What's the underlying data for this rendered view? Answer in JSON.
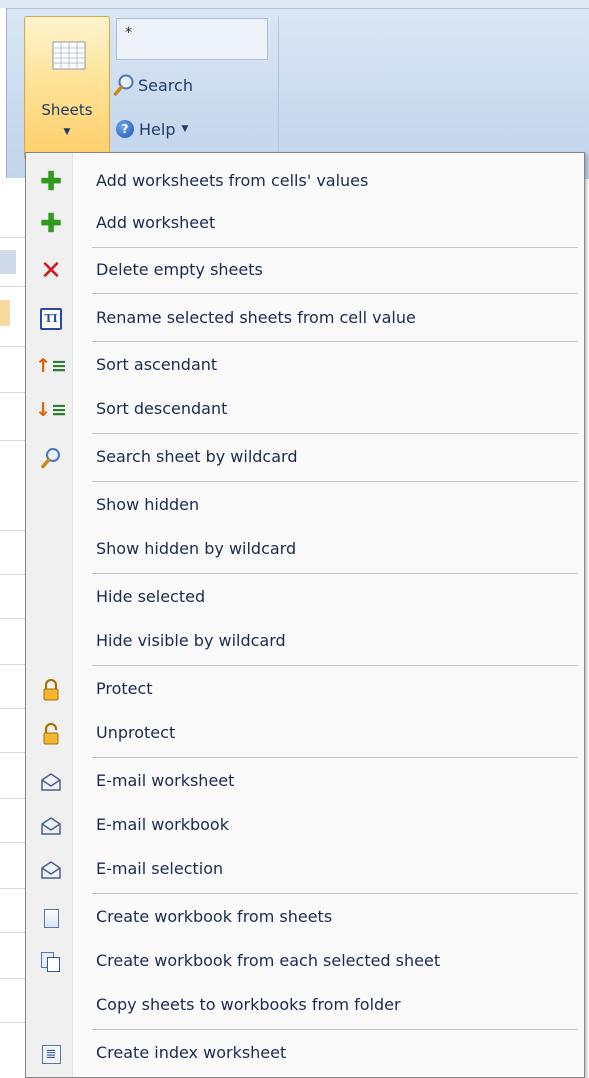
{
  "ribbon": {
    "sheets_button_label": "Sheets",
    "search_field_value": "*",
    "search_label": "Search",
    "help_label": "Help"
  },
  "menu": {
    "items": [
      {
        "label": "Add worksheets from cells' values",
        "icon": "green-plus-icon"
      },
      {
        "label": "Add worksheet",
        "icon": "green-plus-icon"
      },
      {
        "label": "Delete empty sheets",
        "icon": "red-cross-icon"
      },
      {
        "label": "Rename selected sheets from cell value",
        "icon": "rename-text-icon"
      },
      {
        "label": "Sort ascendant",
        "icon": "sort-ascending-icon"
      },
      {
        "label": "Sort descendant",
        "icon": "sort-descending-icon"
      },
      {
        "label": "Search sheet by wildcard",
        "icon": "magnifier-icon"
      },
      {
        "label": "Show hidden",
        "icon": ""
      },
      {
        "label": "Show hidden by wildcard",
        "icon": ""
      },
      {
        "label": "Hide selected",
        "icon": ""
      },
      {
        "label": "Hide visible by wildcard",
        "icon": ""
      },
      {
        "label": "Protect",
        "icon": "lock-closed-icon"
      },
      {
        "label": "Unprotect",
        "icon": "lock-open-icon"
      },
      {
        "label": "E-mail worksheet",
        "icon": "envelope-icon"
      },
      {
        "label": "E-mail workbook",
        "icon": "envelope-icon"
      },
      {
        "label": "E-mail selection",
        "icon": "envelope-icon"
      },
      {
        "label": "Create workbook from sheets",
        "icon": "document-icon"
      },
      {
        "label": "Create workbook from each selected sheet",
        "icon": "documents-icon"
      },
      {
        "label": "Copy sheets to workbooks from folder",
        "icon": ""
      },
      {
        "label": "Create index worksheet",
        "icon": "index-sheet-icon"
      }
    ]
  },
  "colors": {
    "menu_text": "#1c2a52",
    "ribbon_button_active": "#ffe398",
    "ribbon_background": "#cbdbef"
  }
}
